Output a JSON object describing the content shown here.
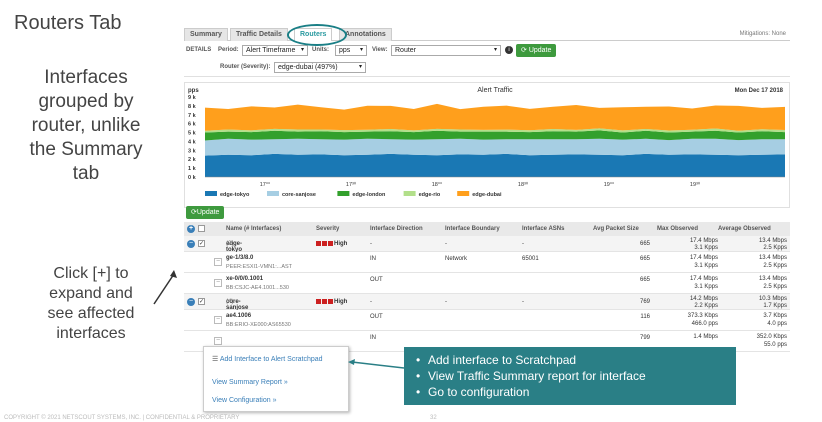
{
  "slide": {
    "title": "Routers Tab",
    "description": "Interfaces\ngrouped by\nrouter, unlike\nthe Summary\ntab",
    "click_note": "Click [+] to\nexpand and\nsee affected\ninterfaces",
    "footer": "COPYRIGHT © 2021 NETSCOUT SYSTEMS, INC. | CONFIDENTIAL & PROPRIETARY",
    "page": "32"
  },
  "tabs": [
    {
      "label": "Summary"
    },
    {
      "label": "Traffic Details"
    },
    {
      "label": "Routers"
    },
    {
      "label": "Annotations"
    }
  ],
  "mitigations": "Mitigations: None",
  "controls": {
    "details_label": "DETAILS",
    "period_label": "Period:",
    "period_value": "Alert Timeframe",
    "units_label": "Units:",
    "units_value": "pps",
    "view_label": "View:",
    "view_value": "Router",
    "update_label": "Update",
    "router_label": "Router (Severity):",
    "router_value": "edge-dubai (497%)"
  },
  "chart_data": {
    "type": "area",
    "title": "Alert Traffic",
    "date": "Mon Dec 17 2018",
    "ylabel": "pps",
    "y_ticks": [
      "9 k",
      "8 k",
      "7 k",
      "6 k",
      "5 k",
      "4 k",
      "3 k",
      "2 k",
      "1 k",
      "0 k"
    ],
    "x_ticks": [
      "17°°",
      "17³⁰",
      "18°°",
      "18³⁰",
      "19°°",
      "19³⁰"
    ],
    "ylim": [
      0,
      9000
    ],
    "stacked": true,
    "series": [
      {
        "name": "edge-tokyo",
        "color": "#1a78b4",
        "values": [
          2400,
          2500,
          2450,
          2600,
          2500,
          2550,
          2450,
          2500,
          2600,
          2500,
          2450,
          2550,
          2500,
          2600,
          2450,
          2500,
          2550,
          2500,
          2450,
          2600,
          2500,
          2550,
          2500,
          2450,
          2500,
          2550
        ]
      },
      {
        "name": "core-sanjose",
        "color": "#a6cee3",
        "values": [
          1700,
          1800,
          1750,
          1650,
          1800,
          1700,
          1750,
          1800,
          1650,
          1700,
          1800,
          1750,
          1700,
          1650,
          1800,
          1750,
          1700,
          1800,
          1750,
          1700,
          1650,
          1750,
          1800,
          1700,
          1750,
          1700
        ]
      },
      {
        "name": "edge-london",
        "color": "#33a02c",
        "values": [
          900,
          800,
          850,
          950,
          800,
          900,
          850,
          800,
          900,
          850,
          950,
          800,
          900,
          850,
          800,
          900,
          850,
          950,
          800,
          900,
          850,
          800,
          900,
          850,
          900,
          800
        ]
      },
      {
        "name": "edge-rio",
        "color": "#b2df8a",
        "values": [
          200,
          250,
          200,
          220,
          240,
          200,
          230,
          210,
          250,
          200,
          220,
          240,
          200,
          230,
          210,
          250,
          200,
          220,
          240,
          200,
          230,
          210,
          250,
          200,
          220,
          240
        ]
      },
      {
        "name": "edge-dubai",
        "color": "#ff9f1c",
        "values": [
          2600,
          2300,
          2700,
          2400,
          2800,
          2500,
          2300,
          2700,
          2600,
          2400,
          2800,
          2300,
          2600,
          2700,
          2400,
          2500,
          2800,
          2300,
          2600,
          2500,
          2700,
          2400,
          2600,
          2800,
          2400,
          2600
        ]
      }
    ]
  },
  "update2_label": "Update",
  "table": {
    "headers": [
      "Name (# Interfaces)",
      "Severity",
      "Interface Direction",
      "Interface Boundary",
      "Interface ASNs",
      "Avg Packet Size",
      "Max Observed",
      "Average Observed"
    ],
    "rows": [
      {
        "kind": "group",
        "name": "edge-tokyo",
        "count": "(2)",
        "severity": "High",
        "direction": "-",
        "boundary": "-",
        "asns": "-",
        "avg_packet": "665",
        "max1": "17.4 Mbps",
        "max2": "3.1 Kpps",
        "avg1": "13.4 Mbps",
        "avg2": "2.5 Kpps"
      },
      {
        "kind": "child",
        "name": "ge-1/3/8.0",
        "sub": "PEER:ESXI1-VMN1:...AST",
        "direction": "IN",
        "boundary": "Network",
        "asns": "65001",
        "avg_packet": "665",
        "max1": "17.4 Mbps",
        "max2": "3.1 Kpps",
        "avg1": "13.4 Mbps",
        "avg2": "2.5 Kpps"
      },
      {
        "kind": "child",
        "name": "xe-0/0/0.1001",
        "sub": "BB:CSJC-AE4.1001...530",
        "direction": "OUT",
        "boundary": "",
        "asns": "",
        "avg_packet": "665",
        "max1": "17.4 Mbps",
        "max2": "3.1 Kpps",
        "avg1": "13.4 Mbps",
        "avg2": "2.5 Kpps"
      },
      {
        "kind": "group",
        "name": "core-sanjose",
        "count": "(4)",
        "severity": "High",
        "direction": "-",
        "boundary": "-",
        "asns": "-",
        "avg_packet": "769",
        "max1": "14.2 Mbps",
        "max2": "2.2 Kpps",
        "avg1": "10.3 Mbps",
        "avg2": "1.7 Kpps"
      },
      {
        "kind": "child",
        "name": "ae4.1006",
        "sub": "BB:ERIO-XE000:AS65530",
        "direction": "OUT",
        "boundary": "",
        "asns": "",
        "avg_packet": "116",
        "max1": "373.3 Kbps",
        "max2": "466.0 pps",
        "avg1": "3.7 Kbps",
        "avg2": "4.0 pps"
      },
      {
        "kind": "child",
        "name": "",
        "sub": "",
        "direction": "IN",
        "boundary": "",
        "asns": "",
        "avg_packet": "799",
        "max1": "1.4 Mbps",
        "max2": "",
        "avg1": "352.0 Kbps",
        "avg2": "55.0 pps"
      }
    ]
  },
  "popup": {
    "item1": "Add Interface to Alert Scratchpad",
    "item2": "View Summary Report »",
    "item3": "View Configuration »"
  },
  "callout": {
    "line1": "Add interface to Scratchpad",
    "line2": "View Traffic Summary report for interface",
    "line3": "Go to configuration"
  }
}
